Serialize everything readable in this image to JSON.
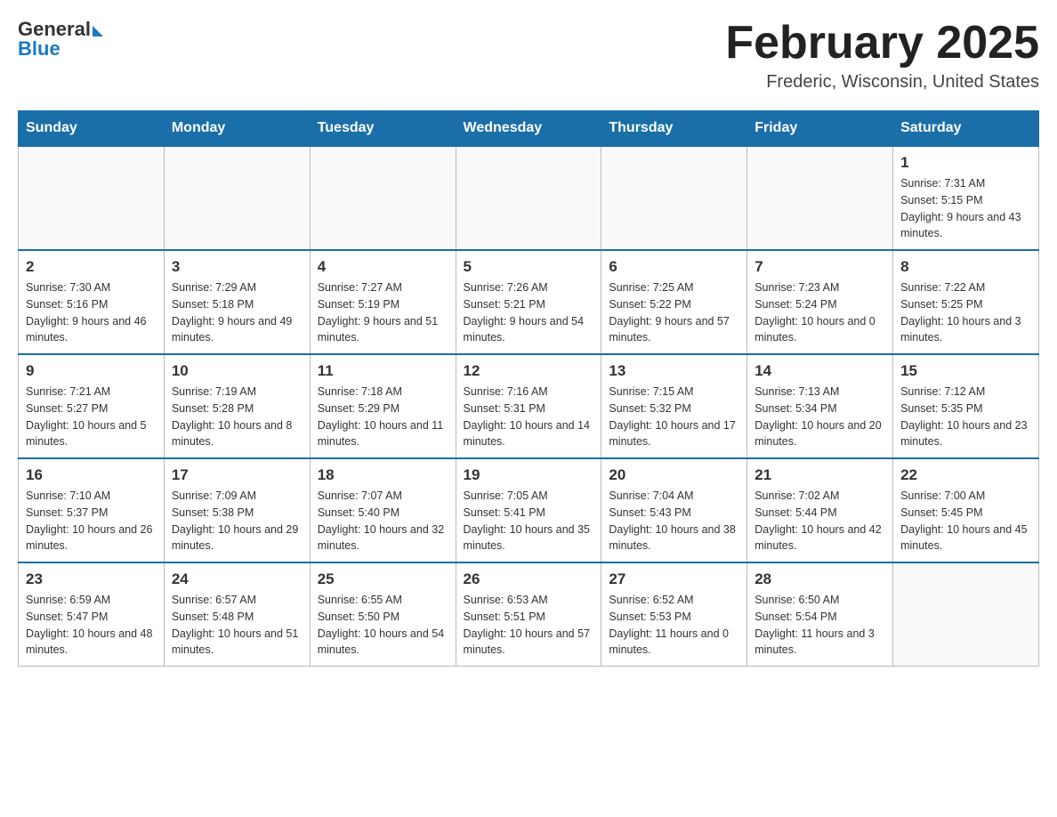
{
  "header": {
    "logo": {
      "general": "General",
      "blue": "Blue"
    },
    "title": "February 2025",
    "subtitle": "Frederic, Wisconsin, United States"
  },
  "weekdays": [
    "Sunday",
    "Monday",
    "Tuesday",
    "Wednesday",
    "Thursday",
    "Friday",
    "Saturday"
  ],
  "weeks": [
    [
      {
        "day": "",
        "info": ""
      },
      {
        "day": "",
        "info": ""
      },
      {
        "day": "",
        "info": ""
      },
      {
        "day": "",
        "info": ""
      },
      {
        "day": "",
        "info": ""
      },
      {
        "day": "",
        "info": ""
      },
      {
        "day": "1",
        "info": "Sunrise: 7:31 AM\nSunset: 5:15 PM\nDaylight: 9 hours and 43 minutes."
      }
    ],
    [
      {
        "day": "2",
        "info": "Sunrise: 7:30 AM\nSunset: 5:16 PM\nDaylight: 9 hours and 46 minutes."
      },
      {
        "day": "3",
        "info": "Sunrise: 7:29 AM\nSunset: 5:18 PM\nDaylight: 9 hours and 49 minutes."
      },
      {
        "day": "4",
        "info": "Sunrise: 7:27 AM\nSunset: 5:19 PM\nDaylight: 9 hours and 51 minutes."
      },
      {
        "day": "5",
        "info": "Sunrise: 7:26 AM\nSunset: 5:21 PM\nDaylight: 9 hours and 54 minutes."
      },
      {
        "day": "6",
        "info": "Sunrise: 7:25 AM\nSunset: 5:22 PM\nDaylight: 9 hours and 57 minutes."
      },
      {
        "day": "7",
        "info": "Sunrise: 7:23 AM\nSunset: 5:24 PM\nDaylight: 10 hours and 0 minutes."
      },
      {
        "day": "8",
        "info": "Sunrise: 7:22 AM\nSunset: 5:25 PM\nDaylight: 10 hours and 3 minutes."
      }
    ],
    [
      {
        "day": "9",
        "info": "Sunrise: 7:21 AM\nSunset: 5:27 PM\nDaylight: 10 hours and 5 minutes."
      },
      {
        "day": "10",
        "info": "Sunrise: 7:19 AM\nSunset: 5:28 PM\nDaylight: 10 hours and 8 minutes."
      },
      {
        "day": "11",
        "info": "Sunrise: 7:18 AM\nSunset: 5:29 PM\nDaylight: 10 hours and 11 minutes."
      },
      {
        "day": "12",
        "info": "Sunrise: 7:16 AM\nSunset: 5:31 PM\nDaylight: 10 hours and 14 minutes."
      },
      {
        "day": "13",
        "info": "Sunrise: 7:15 AM\nSunset: 5:32 PM\nDaylight: 10 hours and 17 minutes."
      },
      {
        "day": "14",
        "info": "Sunrise: 7:13 AM\nSunset: 5:34 PM\nDaylight: 10 hours and 20 minutes."
      },
      {
        "day": "15",
        "info": "Sunrise: 7:12 AM\nSunset: 5:35 PM\nDaylight: 10 hours and 23 minutes."
      }
    ],
    [
      {
        "day": "16",
        "info": "Sunrise: 7:10 AM\nSunset: 5:37 PM\nDaylight: 10 hours and 26 minutes."
      },
      {
        "day": "17",
        "info": "Sunrise: 7:09 AM\nSunset: 5:38 PM\nDaylight: 10 hours and 29 minutes."
      },
      {
        "day": "18",
        "info": "Sunrise: 7:07 AM\nSunset: 5:40 PM\nDaylight: 10 hours and 32 minutes."
      },
      {
        "day": "19",
        "info": "Sunrise: 7:05 AM\nSunset: 5:41 PM\nDaylight: 10 hours and 35 minutes."
      },
      {
        "day": "20",
        "info": "Sunrise: 7:04 AM\nSunset: 5:43 PM\nDaylight: 10 hours and 38 minutes."
      },
      {
        "day": "21",
        "info": "Sunrise: 7:02 AM\nSunset: 5:44 PM\nDaylight: 10 hours and 42 minutes."
      },
      {
        "day": "22",
        "info": "Sunrise: 7:00 AM\nSunset: 5:45 PM\nDaylight: 10 hours and 45 minutes."
      }
    ],
    [
      {
        "day": "23",
        "info": "Sunrise: 6:59 AM\nSunset: 5:47 PM\nDaylight: 10 hours and 48 minutes."
      },
      {
        "day": "24",
        "info": "Sunrise: 6:57 AM\nSunset: 5:48 PM\nDaylight: 10 hours and 51 minutes."
      },
      {
        "day": "25",
        "info": "Sunrise: 6:55 AM\nSunset: 5:50 PM\nDaylight: 10 hours and 54 minutes."
      },
      {
        "day": "26",
        "info": "Sunrise: 6:53 AM\nSunset: 5:51 PM\nDaylight: 10 hours and 57 minutes."
      },
      {
        "day": "27",
        "info": "Sunrise: 6:52 AM\nSunset: 5:53 PM\nDaylight: 11 hours and 0 minutes."
      },
      {
        "day": "28",
        "info": "Sunrise: 6:50 AM\nSunset: 5:54 PM\nDaylight: 11 hours and 3 minutes."
      },
      {
        "day": "",
        "info": ""
      }
    ]
  ]
}
